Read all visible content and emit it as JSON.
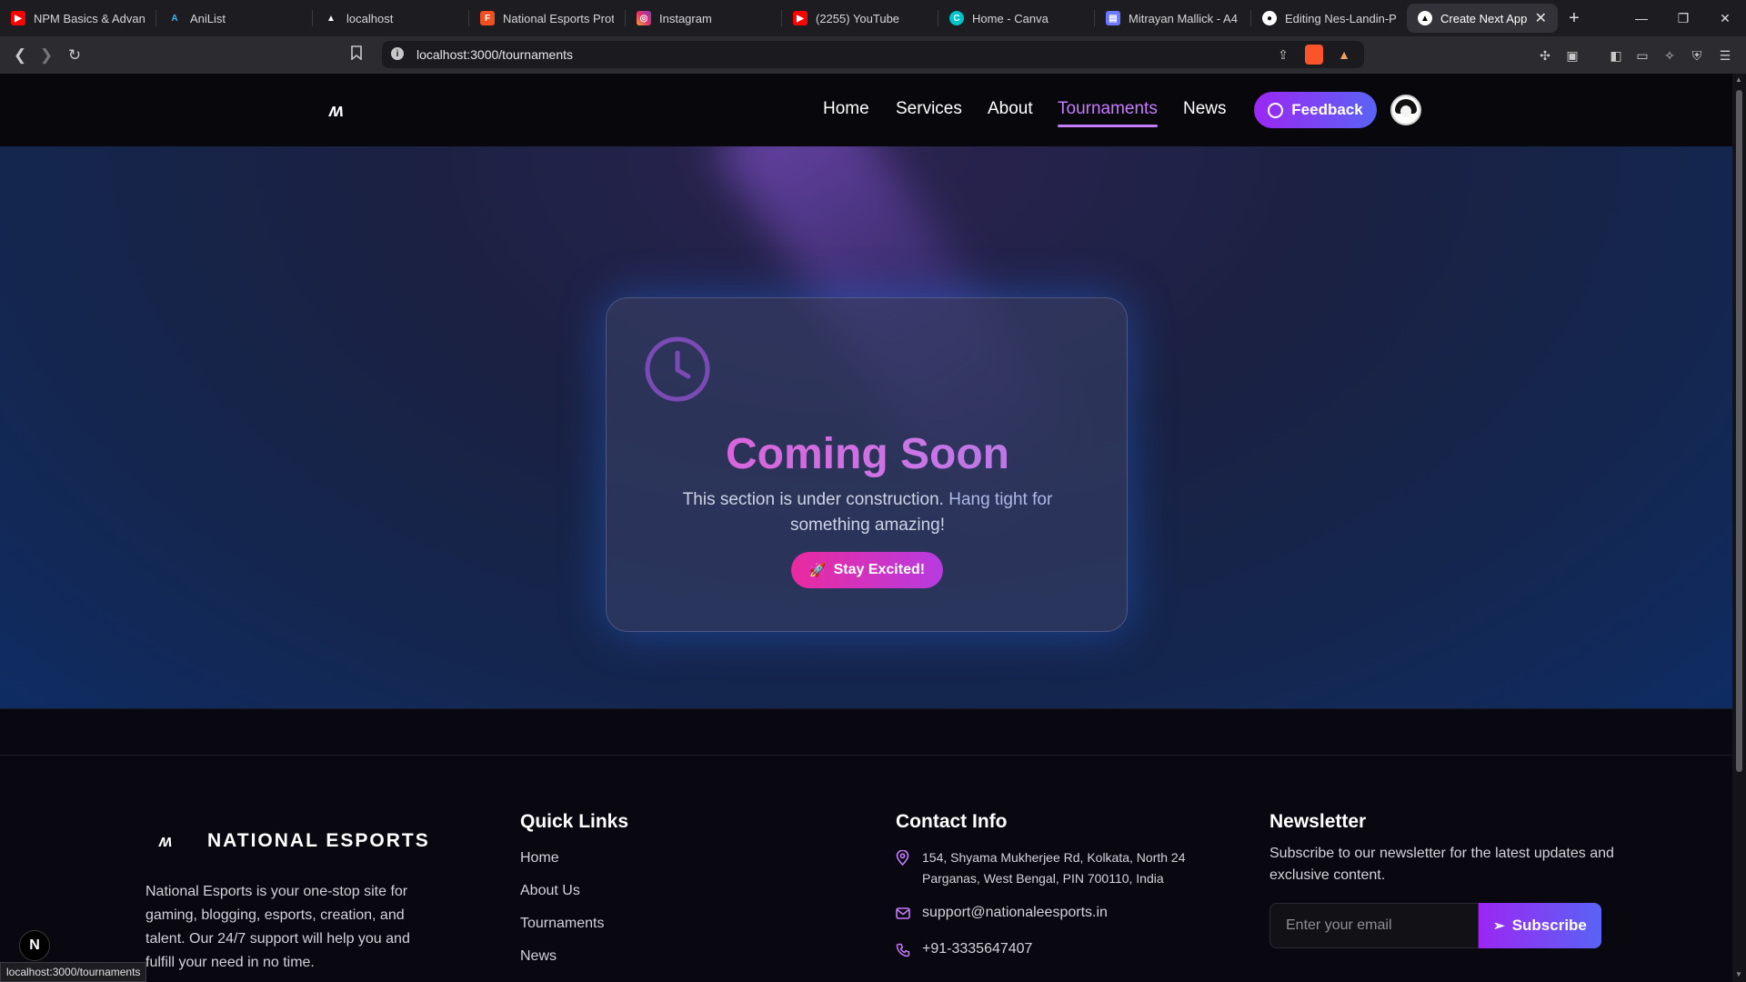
{
  "browser": {
    "tabs": [
      {
        "title": "NPM Basics & Advance",
        "icon": "youtube-icon",
        "color": "#ff0000"
      },
      {
        "title": "AniList",
        "icon": "anilist-icon",
        "color": "#3db4f2"
      },
      {
        "title": "localhost",
        "icon": "nextjs-icon",
        "color": "#ffffff"
      },
      {
        "title": "National Esports Protot",
        "icon": "figma-icon",
        "color": "#f24e1e"
      },
      {
        "title": "Instagram",
        "icon": "instagram-icon",
        "color": "#e1306c"
      },
      {
        "title": "(2255) YouTube",
        "icon": "youtube-icon",
        "color": "#ff0000"
      },
      {
        "title": "Home - Canva",
        "icon": "canva-icon",
        "color": "#00c4cc"
      },
      {
        "title": "Mitrayan Mallick - A4",
        "icon": "doc-icon",
        "color": "#6b78ff"
      },
      {
        "title": "Editing Nes-Landin-Pa",
        "icon": "github-icon",
        "color": "#ffffff"
      },
      {
        "title": "Create Next App",
        "icon": "nextjs-icon",
        "color": "#ffffff",
        "active": true
      }
    ],
    "url": "localhost:3000/tournaments",
    "status_url": "localhost:3000/tournaments"
  },
  "nav": {
    "logo": "ʍ",
    "links": [
      "Home",
      "Services",
      "About",
      "Tournaments",
      "News"
    ],
    "active": "Tournaments",
    "feedback_label": "Feedback"
  },
  "hero": {
    "title": "Coming Soon",
    "subtitle_plain": "This section is under construction.",
    "subtitle_highlight": "Hang tight for",
    "subtitle_end": "something amazing!",
    "button_label": "Stay Excited!"
  },
  "footer": {
    "brand": "NATIONAL ESPORTS",
    "description": "National Esports is your one-stop site for gaming, blogging, esports, creation, and talent. Our 24/7 support will help you and fulfill your need in no time.",
    "quick_links_title": "Quick Links",
    "quick_links": [
      "Home",
      "About Us",
      "Tournaments",
      "News"
    ],
    "contact_title": "Contact Info",
    "address_line1": "154, Shyama Mukherjee Rd, Kolkata, North 24",
    "address_line2": "Parganas, West Bengal, PIN 700110, India",
    "email": "support@nationaleesports.in",
    "phone": "+91-3335647407",
    "newsletter_title": "Newsletter",
    "newsletter_text": "Subscribe to our newsletter for the latest updates and exclusive content.",
    "email_placeholder": "Enter your email",
    "subscribe_label": "Subscribe"
  },
  "colors": {
    "accent_purple": "#9b27f2",
    "accent_blue": "#5a63f5",
    "active_link": "#c67bff",
    "title_pink": "#e45ad6"
  }
}
